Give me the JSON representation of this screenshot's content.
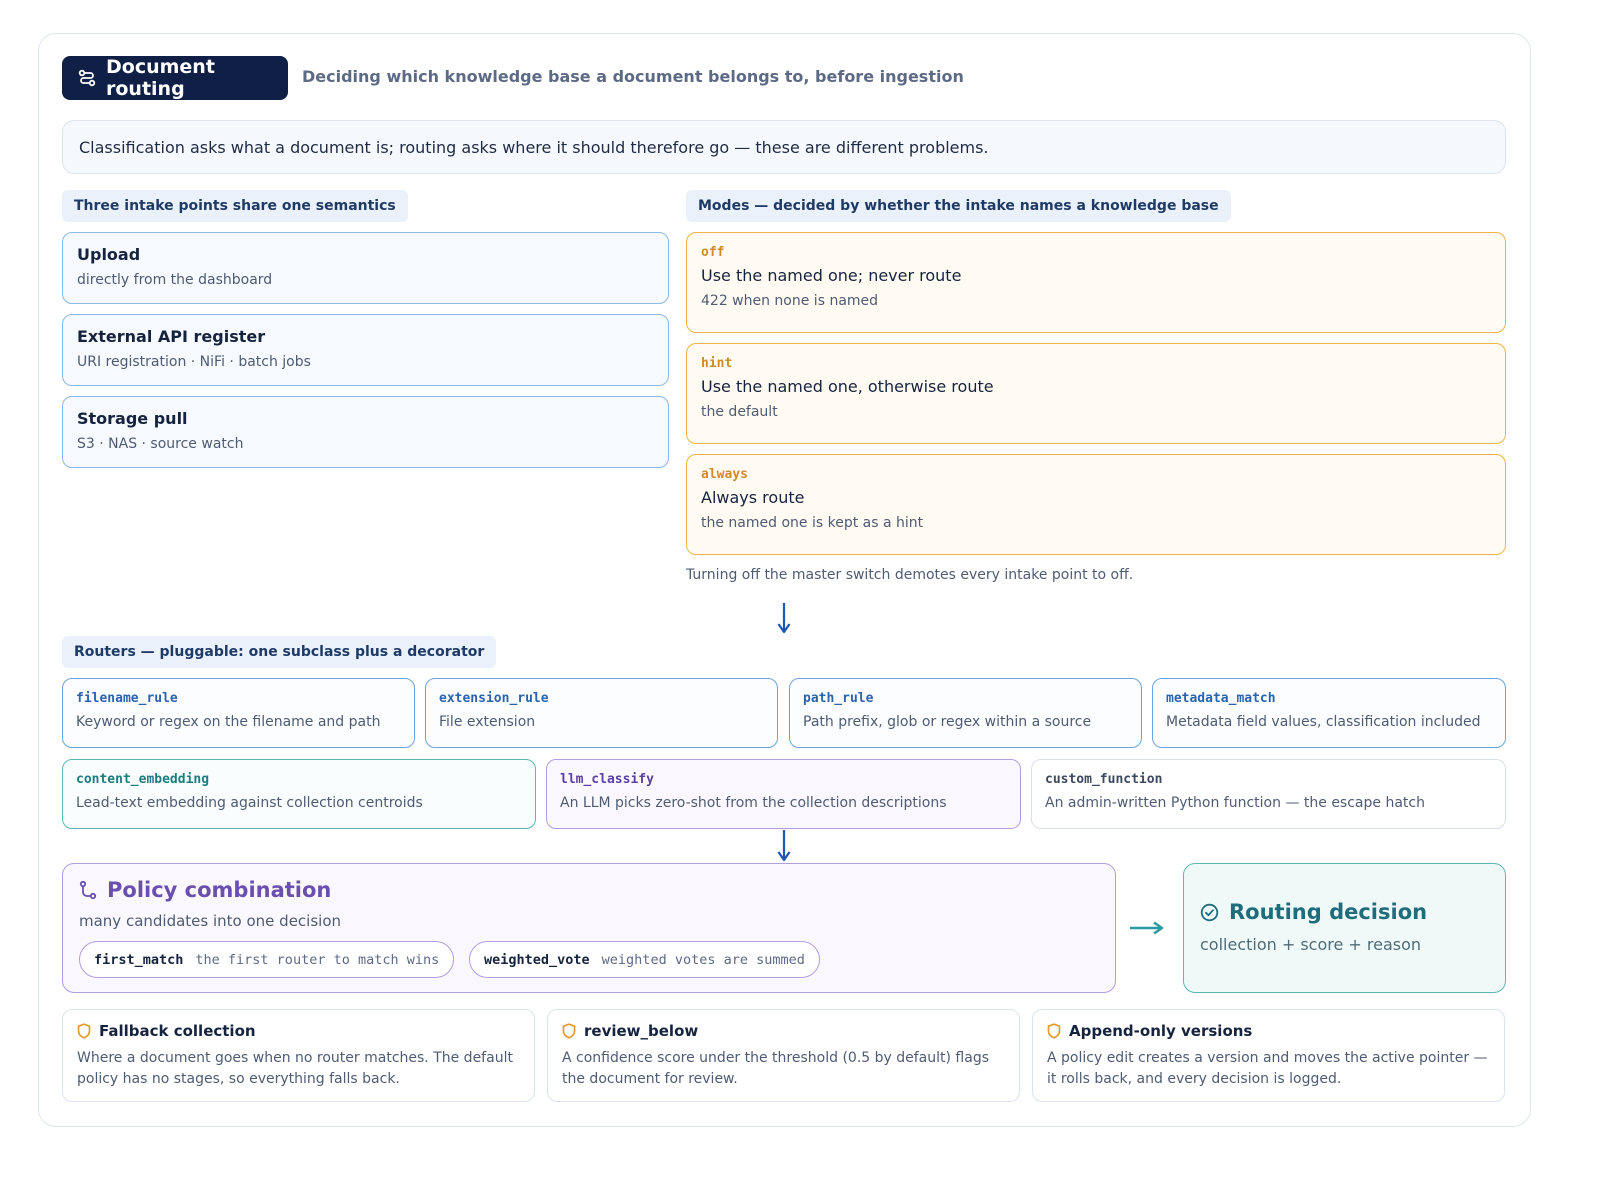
{
  "header": {
    "title": "Document routing",
    "subtitle": "Deciding which knowledge base a document belongs to, before ingestion"
  },
  "banner": "Classification asks what a document is; routing asks where it should therefore go — these are different problems.",
  "intake": {
    "label": "Three intake points share one semantics",
    "items": [
      {
        "title": "Upload",
        "desc": "directly from the dashboard"
      },
      {
        "title": "External API register",
        "desc": "URI registration · NiFi · batch jobs"
      },
      {
        "title": "Storage pull",
        "desc": "S3 · NAS · source watch"
      }
    ]
  },
  "modes": {
    "label": "Modes — decided by whether the intake names a knowledge base",
    "items": [
      {
        "code": "off",
        "title": "Use the named one; never route",
        "desc": "422 when none is named"
      },
      {
        "code": "hint",
        "title": "Use the named one, otherwise route",
        "desc": "the default"
      },
      {
        "code": "always",
        "title": "Always route",
        "desc": "the named one is kept as a hint"
      }
    ],
    "note": "Turning off the master switch demotes every intake point to off."
  },
  "routers": {
    "label": "Routers — pluggable: one subclass plus a decorator",
    "items": [
      {
        "code": "filename_rule",
        "desc": "Keyword or regex on the filename and path"
      },
      {
        "code": "extension_rule",
        "desc": "File extension"
      },
      {
        "code": "path_rule",
        "desc": "Path prefix, glob or regex within a source"
      },
      {
        "code": "metadata_match",
        "desc": "Metadata field values, classification included"
      },
      {
        "code": "content_embedding",
        "desc": "Lead-text embedding against collection centroids"
      },
      {
        "code": "llm_classify",
        "desc": "An LLM picks zero-shot from the collection descriptions"
      },
      {
        "code": "custom_function",
        "desc": "An admin-written Python function — the escape hatch"
      }
    ]
  },
  "policy": {
    "title": "Policy combination",
    "subtitle": "many candidates into one decision",
    "options": [
      {
        "key": "first_match",
        "desc": "the first router to match wins"
      },
      {
        "key": "weighted_vote",
        "desc": "weighted votes are summed"
      }
    ]
  },
  "decision": {
    "title": "Routing decision",
    "subtitle": "collection + score + reason"
  },
  "notes": [
    {
      "title": "Fallback collection",
      "desc": "Where a document goes when no router matches. The default policy has no stages, so everything falls back."
    },
    {
      "title": "review_below",
      "desc": "A confidence score under the threshold (0.5 by default) flags the document for review."
    },
    {
      "title": "Append-only versions",
      "desc": "A policy edit creates a version and moves the active pointer — it rolls back, and every decision is logged."
    }
  ],
  "icons": {
    "title": "route-icon",
    "policy": "merge-icon",
    "decision": "check-circle-icon",
    "notes": "shield-icon"
  },
  "colors": {
    "navy": "#0f1f45",
    "intake_border": "#8cb9e6",
    "mode_border": "#efb349",
    "router_blue": "#6ea3dd",
    "router_teal": "#5bb8b6",
    "router_purple": "#b39ddf",
    "policy_purple": "#6a4fb0",
    "decision_teal": "#1f6d7c",
    "arrow_blue": "#1c56b0",
    "note_orange": "#e49b2e"
  }
}
